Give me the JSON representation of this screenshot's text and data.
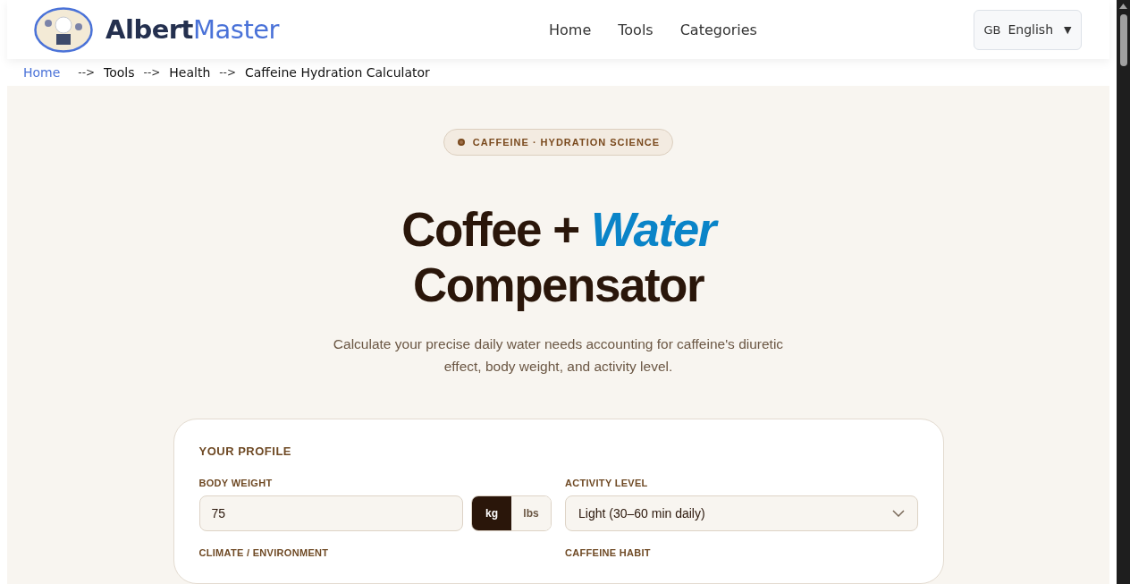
{
  "header": {
    "brand": {
      "part_1": "Albert",
      "part_2": "Master"
    },
    "nav": [
      "Home",
      "Tools",
      "Categories"
    ],
    "language": {
      "code": "GB",
      "label": "English",
      "caret": "▼"
    }
  },
  "breadcrumb": {
    "items": [
      "Home",
      "Tools",
      "Health",
      "Caffeine Hydration Calculator"
    ],
    "separator": "-->"
  },
  "hero": {
    "badge": "CAFFEINE · HYDRATION SCIENCE",
    "title_part_1": "Coffee + ",
    "title_highlight": "Water",
    "title_part_2": "Compensator",
    "subtitle": "Calculate your precise daily water needs accounting for caffeine's diuretic effect, body weight, and activity level."
  },
  "profile": {
    "title": "YOUR PROFILE",
    "fields": [
      {
        "kind": "weight",
        "label": "BODY WEIGHT",
        "value": "75",
        "units": [
          {
            "label": "kg",
            "selected": true
          },
          {
            "label": "lbs",
            "selected": false
          }
        ]
      },
      {
        "kind": "select",
        "label": "ACTIVITY LEVEL",
        "value": "Light (30–60 min daily)"
      },
      {
        "kind": "label",
        "label": "CLIMATE / ENVIRONMENT"
      },
      {
        "kind": "label",
        "label": "CAFFEINE HABIT"
      }
    ]
  }
}
